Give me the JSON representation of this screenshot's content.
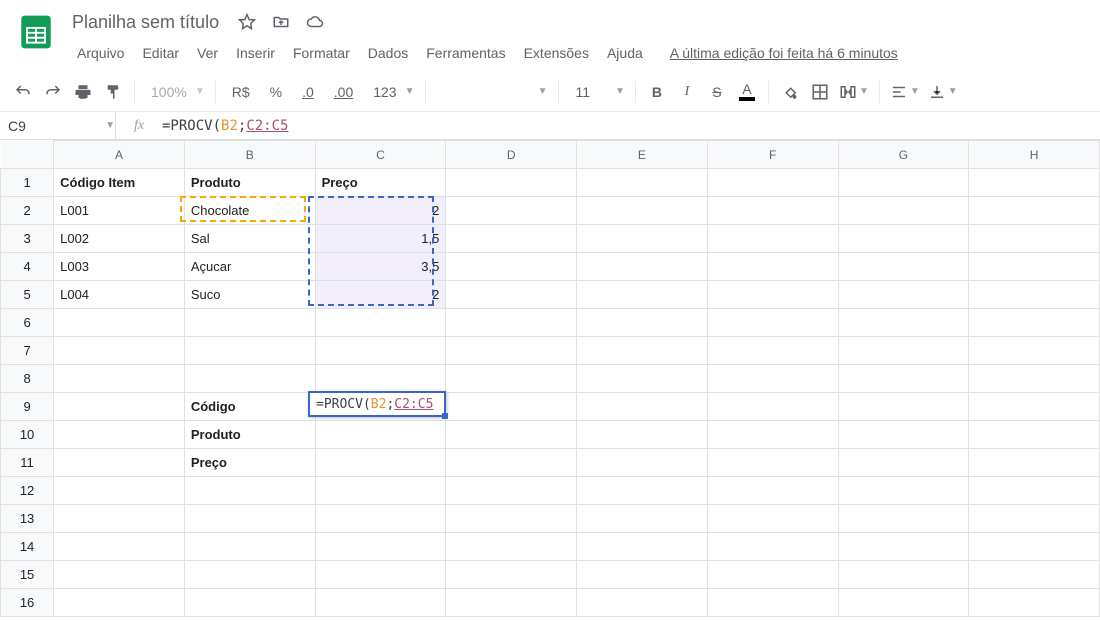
{
  "doc_title": "Planilha sem título",
  "menus": [
    "Arquivo",
    "Editar",
    "Ver",
    "Inserir",
    "Formatar",
    "Dados",
    "Ferramentas",
    "Extensões",
    "Ajuda"
  ],
  "last_edit": "A última edição foi feita há 6 minutos",
  "toolbar": {
    "zoom": "100%",
    "currency": "R$",
    "percent": "%",
    "dec_less": ".0",
    "dec_more": ".00",
    "numfmt": "123",
    "font_size": "11",
    "bold": "B",
    "italic": "I",
    "strike": "S",
    "textcolor": "A"
  },
  "namebox": "C9",
  "fx_sym": "fx",
  "formula": {
    "func": "=PROCV(",
    "arg1": "B2",
    "sep": ";",
    "arg2": "C2:C5"
  },
  "columns": [
    "A",
    "B",
    "C",
    "D",
    "E",
    "F",
    "G",
    "H"
  ],
  "rows": 16,
  "cells": {
    "A1": {
      "v": "Código Item",
      "bold": true
    },
    "B1": {
      "v": "Produto",
      "bold": true
    },
    "C1": {
      "v": "Preço",
      "bold": true
    },
    "A2": {
      "v": "L001"
    },
    "B2": {
      "v": "Chocolate"
    },
    "C2": {
      "v": "2",
      "num": true,
      "hl": true
    },
    "A3": {
      "v": "L002"
    },
    "B3": {
      "v": "Sal"
    },
    "C3": {
      "v": "1,5",
      "num": true,
      "hl": true
    },
    "A4": {
      "v": "L003"
    },
    "B4": {
      "v": "Açucar"
    },
    "C4": {
      "v": "3,5",
      "num": true,
      "hl": true
    },
    "A5": {
      "v": "L004"
    },
    "B5": {
      "v": "Suco"
    },
    "C5": {
      "v": "2",
      "num": true,
      "hl": true
    },
    "B9": {
      "v": "Código",
      "bold": true
    },
    "B10": {
      "v": "Produto",
      "bold": true
    },
    "B11": {
      "v": "Preço",
      "bold": true
    }
  },
  "editor_cell": "C9",
  "overlays": {
    "orange_ref": "B2",
    "blue_range": [
      "C2",
      "C5"
    ]
  }
}
